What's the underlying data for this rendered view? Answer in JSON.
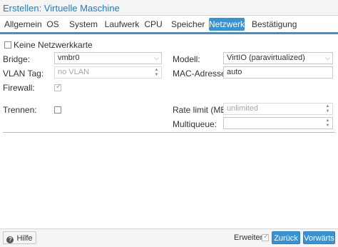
{
  "window": {
    "title": "Erstellen: Virtuelle Maschine"
  },
  "tabs": [
    {
      "label": "Allgemein",
      "active": false
    },
    {
      "label": "OS",
      "active": false
    },
    {
      "label": "System",
      "active": false
    },
    {
      "label": "Laufwerk",
      "active": false
    },
    {
      "label": "CPU",
      "active": false
    },
    {
      "label": "Speicher",
      "active": false
    },
    {
      "label": "Netzwerk",
      "active": true
    },
    {
      "label": "Bestätigung",
      "active": false
    }
  ],
  "form": {
    "no_nic": {
      "label": "Keine Netzwerkkarte",
      "checked": false
    },
    "bridge": {
      "label": "Bridge:",
      "value": "vmbr0"
    },
    "vlan": {
      "label": "VLAN Tag:",
      "placeholder": "no VLAN"
    },
    "firewall": {
      "label": "Firewall:",
      "checked": true
    },
    "model": {
      "label": "Modell:",
      "value": "VirtIO (paravirtualized)"
    },
    "mac": {
      "label": "MAC-Adresse:",
      "value": "auto"
    },
    "disconnect": {
      "label": "Trennen:",
      "checked": false
    },
    "rate_limit": {
      "label": "Rate limit (MB/s):",
      "placeholder": "unlimited"
    },
    "multiqueue": {
      "label": "Multiqueue:",
      "value": ""
    }
  },
  "footer": {
    "help_label": "Hilfe",
    "advanced_label": "Erweitert",
    "advanced_checked": true,
    "back_label": "Zurück",
    "next_label": "Vorwärts"
  },
  "colors": {
    "accent": "#3892d4",
    "title": "#157fcc"
  }
}
